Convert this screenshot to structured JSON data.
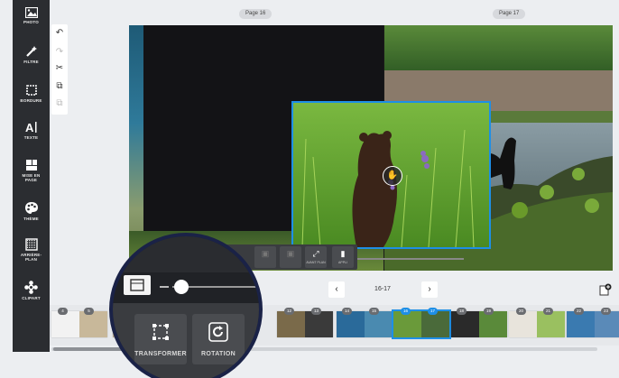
{
  "sidebar": {
    "items": [
      {
        "label": "PHOTO",
        "icon": "photo-icon"
      },
      {
        "label": "FILTRE",
        "icon": "magic-wand-icon"
      },
      {
        "label": "BORDURE",
        "icon": "border-icon"
      },
      {
        "label": "TEXTE",
        "icon": "text-icon"
      },
      {
        "label": "MISE EN PAGE",
        "icon": "layout-icon"
      },
      {
        "label": "THÈME",
        "icon": "palette-icon"
      },
      {
        "label": "ARRIÈRE-PLAN",
        "icon": "background-icon"
      },
      {
        "label": "CLIPART",
        "icon": "clipart-icon"
      }
    ]
  },
  "pages": {
    "left_label": "Page 16",
    "right_label": "Page 17"
  },
  "toolbar": {
    "avant_label": "AVANT PLAN",
    "apply_label": "APPLI"
  },
  "nav": {
    "range": "16-17",
    "prev": "‹",
    "next": "›"
  },
  "filmstrip": {
    "pages": [
      "4",
      "5",
      "8",
      "9",
      "12",
      "13",
      "14",
      "15",
      "16",
      "17",
      "18",
      "19",
      "20",
      "21",
      "22",
      "23"
    ]
  },
  "magnifier": {
    "transform_label": "TRANSFORMER",
    "rotation_label": "ROTATION"
  },
  "colors": {
    "accent": "#1e8fe6",
    "sidebar": "#2b2d31",
    "magnifier_border": "#1a2247"
  }
}
